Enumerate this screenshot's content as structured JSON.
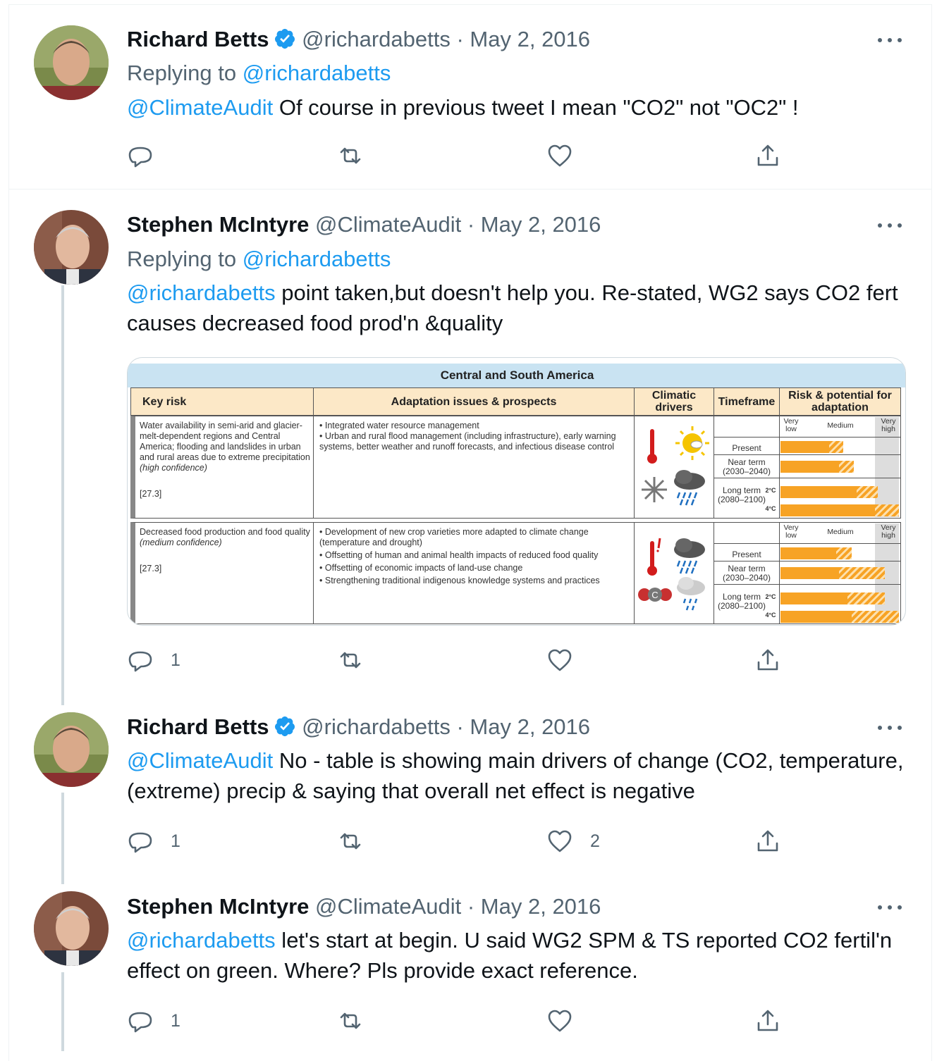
{
  "tweets": [
    {
      "name": "Richard Betts",
      "verified": true,
      "handle": "@richardabetts",
      "date": "May 2, 2016",
      "replying_label": "Replying to",
      "replying_to": "@richardabetts",
      "mention": "@ClimateAudit",
      "body": " Of course in previous tweet I mean \"CO2\" not \"OC2\" !",
      "reply_count": "",
      "retweet_count": "",
      "like_count": ""
    },
    {
      "name": "Stephen McIntyre",
      "verified": false,
      "handle": "@ClimateAudit",
      "date": "May 2, 2016",
      "replying_label": "Replying to",
      "replying_to": "@richardabetts",
      "mention": "@richardabetts",
      "body": " point taken,but doesn't help you. Re-stated, WG2 says CO2 fert causes decreased food prod'n &quality",
      "reply_count": "1",
      "retweet_count": "",
      "like_count": ""
    },
    {
      "name": "Richard Betts",
      "verified": true,
      "handle": "@richardabetts",
      "date": "May 2, 2016",
      "mention": "@ClimateAudit",
      "body": " No - table is showing main drivers of change (CO2, temperature, (extreme) precip & saying that overall net effect is negative",
      "reply_count": "1",
      "retweet_count": "",
      "like_count": "2"
    },
    {
      "name": "Stephen McIntyre",
      "verified": false,
      "handle": "@ClimateAudit",
      "date": "May 2, 2016",
      "mention": "@richardabetts",
      "body": " let's start at begin. U said WG2 SPM & TS reported CO2 fertil'n effect on green. Where? Pls provide exact reference.",
      "reply_count": "1",
      "retweet_count": "",
      "like_count": ""
    }
  ],
  "media_table": {
    "title": "Central and South America",
    "headers": {
      "key_risk": "Key risk",
      "adaptation": "Adaptation issues & prospects",
      "climatic": "Climatic drivers",
      "timeframe": "Timeframe",
      "risk": "Risk & potential for adaptation"
    },
    "scale": {
      "low": "Very low",
      "medium": "Medium",
      "high": "Very high"
    },
    "timeframes": {
      "present": "Present",
      "near": "Near term (2030–2040)",
      "long": "Long term (2080–2100)",
      "deg2": "2°C",
      "deg4": "4°C"
    },
    "rows": [
      {
        "risk_text": "Water availability in semi-arid and glacier-melt-dependent regions and Central America; flooding and landslides in urban and rural areas due to extreme precipitation",
        "confidence": "(high confidence)",
        "ref": "[27.3]",
        "adaptation": [
          "Integrated water resource management",
          "Urban and rural flood management (including infrastructure), early warning systems, better weather and runoff forecasts, and infectious disease control"
        ],
        "risk_levels": {
          "present": 0.53,
          "near": 0.62,
          "long2": 0.82,
          "long4": 1.0
        },
        "uncertainty": {
          "present": 0.22,
          "near": 0.2,
          "long2": 0.22,
          "long4": 0.2
        }
      },
      {
        "risk_text": "Decreased food production and food quality",
        "confidence": "(medium confidence)",
        "ref": "[27.3]",
        "adaptation": [
          "Development of new crop varieties more adapted to climate change (temperature and drought)",
          "Offsetting of human and animal health impacts of reduced food quality",
          "Offsetting of economic impacts of land-use change",
          "Strengthening traditional indigenous knowledge systems and practices"
        ],
        "risk_levels": {
          "present": 0.6,
          "near": 0.88,
          "long2": 0.88,
          "long4": 1.0
        },
        "uncertainty": {
          "present": 0.22,
          "near": 0.44,
          "long2": 0.36,
          "long4": 0.4
        }
      }
    ]
  },
  "colors": {
    "link": "#1d9bf0",
    "muted": "#536471",
    "verified": "#1d9bf0",
    "bar": "#f7a325"
  }
}
